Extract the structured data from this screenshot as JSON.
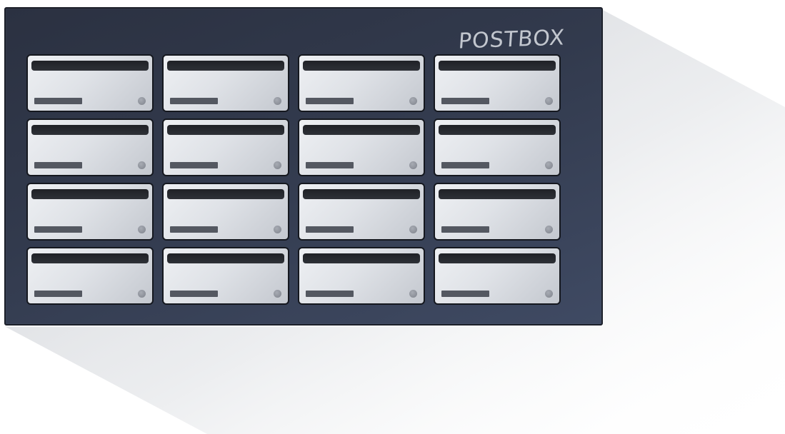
{
  "cabinet": {
    "brand_label": "POSTBOX",
    "grid_rows": 4,
    "grid_columns": 4
  },
  "colors": {
    "cabinet_body": "#323a4d",
    "mailbox_door": "#dfe2e7",
    "slot": "#262930",
    "nameplate": "#545861",
    "knob": "#8b8f98"
  },
  "mailboxes": [
    {
      "id": "1"
    },
    {
      "id": "2"
    },
    {
      "id": "3"
    },
    {
      "id": "4"
    },
    {
      "id": "5"
    },
    {
      "id": "6"
    },
    {
      "id": "7"
    },
    {
      "id": "8"
    },
    {
      "id": "9"
    },
    {
      "id": "10"
    },
    {
      "id": "11"
    },
    {
      "id": "12"
    },
    {
      "id": "13"
    },
    {
      "id": "14"
    },
    {
      "id": "15"
    },
    {
      "id": "16"
    }
  ]
}
